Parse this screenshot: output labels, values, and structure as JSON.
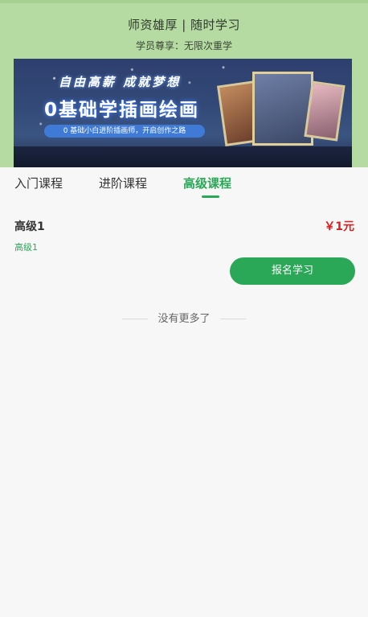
{
  "header": {
    "slogan": "师资雄厚 | 随时学习",
    "perk": "学员尊享：无限次重学"
  },
  "banner": {
    "tagline": "自由高薪 成就梦想",
    "headline": "0基础学插画绘画",
    "pill": "0 基础小白进阶插画师，开启创作之路"
  },
  "tabs": [
    {
      "label": "入门课程",
      "active": false
    },
    {
      "label": "进阶课程",
      "active": false
    },
    {
      "label": "高级课程",
      "active": true
    }
  ],
  "course": {
    "title": "高级1",
    "subtitle": "高级1",
    "price": "￥1元",
    "enroll_label": "报名学习"
  },
  "footer": {
    "no_more": "没有更多了"
  },
  "colors": {
    "accent": "#2aa757",
    "price": "#d91f1f",
    "header_bg": "#b5dba2"
  }
}
